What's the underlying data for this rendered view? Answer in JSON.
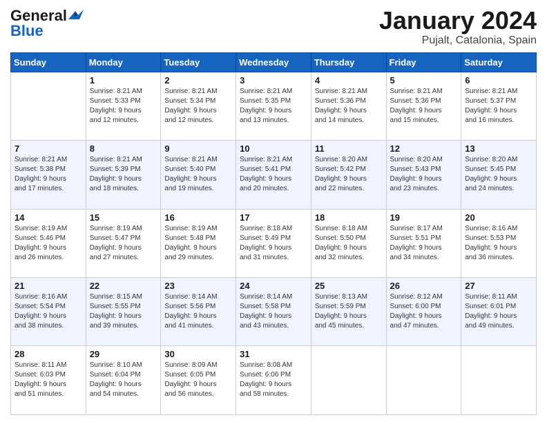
{
  "logo": {
    "line1": "General",
    "line2": "Blue"
  },
  "header": {
    "month": "January 2024",
    "location": "Pujalt, Catalonia, Spain"
  },
  "weekdays": [
    "Sunday",
    "Monday",
    "Tuesday",
    "Wednesday",
    "Thursday",
    "Friday",
    "Saturday"
  ],
  "weeks": [
    [
      {
        "day": "",
        "info": ""
      },
      {
        "day": "1",
        "info": "Sunrise: 8:21 AM\nSunset: 5:33 PM\nDaylight: 9 hours\nand 12 minutes."
      },
      {
        "day": "2",
        "info": "Sunrise: 8:21 AM\nSunset: 5:34 PM\nDaylight: 9 hours\nand 12 minutes."
      },
      {
        "day": "3",
        "info": "Sunrise: 8:21 AM\nSunset: 5:35 PM\nDaylight: 9 hours\nand 13 minutes."
      },
      {
        "day": "4",
        "info": "Sunrise: 8:21 AM\nSunset: 5:36 PM\nDaylight: 9 hours\nand 14 minutes."
      },
      {
        "day": "5",
        "info": "Sunrise: 8:21 AM\nSunset: 5:36 PM\nDaylight: 9 hours\nand 15 minutes."
      },
      {
        "day": "6",
        "info": "Sunrise: 8:21 AM\nSunset: 5:37 PM\nDaylight: 9 hours\nand 16 minutes."
      }
    ],
    [
      {
        "day": "7",
        "info": "Sunrise: 8:21 AM\nSunset: 5:38 PM\nDaylight: 9 hours\nand 17 minutes."
      },
      {
        "day": "8",
        "info": "Sunrise: 8:21 AM\nSunset: 5:39 PM\nDaylight: 9 hours\nand 18 minutes."
      },
      {
        "day": "9",
        "info": "Sunrise: 8:21 AM\nSunset: 5:40 PM\nDaylight: 9 hours\nand 19 minutes."
      },
      {
        "day": "10",
        "info": "Sunrise: 8:21 AM\nSunset: 5:41 PM\nDaylight: 9 hours\nand 20 minutes."
      },
      {
        "day": "11",
        "info": "Sunrise: 8:20 AM\nSunset: 5:42 PM\nDaylight: 9 hours\nand 22 minutes."
      },
      {
        "day": "12",
        "info": "Sunrise: 8:20 AM\nSunset: 5:43 PM\nDaylight: 9 hours\nand 23 minutes."
      },
      {
        "day": "13",
        "info": "Sunrise: 8:20 AM\nSunset: 5:45 PM\nDaylight: 9 hours\nand 24 minutes."
      }
    ],
    [
      {
        "day": "14",
        "info": "Sunrise: 8:19 AM\nSunset: 5:46 PM\nDaylight: 9 hours\nand 26 minutes."
      },
      {
        "day": "15",
        "info": "Sunrise: 8:19 AM\nSunset: 5:47 PM\nDaylight: 9 hours\nand 27 minutes."
      },
      {
        "day": "16",
        "info": "Sunrise: 8:19 AM\nSunset: 5:48 PM\nDaylight: 9 hours\nand 29 minutes."
      },
      {
        "day": "17",
        "info": "Sunrise: 8:18 AM\nSunset: 5:49 PM\nDaylight: 9 hours\nand 31 minutes."
      },
      {
        "day": "18",
        "info": "Sunrise: 8:18 AM\nSunset: 5:50 PM\nDaylight: 9 hours\nand 32 minutes."
      },
      {
        "day": "19",
        "info": "Sunrise: 8:17 AM\nSunset: 5:51 PM\nDaylight: 9 hours\nand 34 minutes."
      },
      {
        "day": "20",
        "info": "Sunrise: 8:16 AM\nSunset: 5:53 PM\nDaylight: 9 hours\nand 36 minutes."
      }
    ],
    [
      {
        "day": "21",
        "info": "Sunrise: 8:16 AM\nSunset: 5:54 PM\nDaylight: 9 hours\nand 38 minutes."
      },
      {
        "day": "22",
        "info": "Sunrise: 8:15 AM\nSunset: 5:55 PM\nDaylight: 9 hours\nand 39 minutes."
      },
      {
        "day": "23",
        "info": "Sunrise: 8:14 AM\nSunset: 5:56 PM\nDaylight: 9 hours\nand 41 minutes."
      },
      {
        "day": "24",
        "info": "Sunrise: 8:14 AM\nSunset: 5:58 PM\nDaylight: 9 hours\nand 43 minutes."
      },
      {
        "day": "25",
        "info": "Sunrise: 8:13 AM\nSunset: 5:59 PM\nDaylight: 9 hours\nand 45 minutes."
      },
      {
        "day": "26",
        "info": "Sunrise: 8:12 AM\nSunset: 6:00 PM\nDaylight: 9 hours\nand 47 minutes."
      },
      {
        "day": "27",
        "info": "Sunrise: 8:11 AM\nSunset: 6:01 PM\nDaylight: 9 hours\nand 49 minutes."
      }
    ],
    [
      {
        "day": "28",
        "info": "Sunrise: 8:11 AM\nSunset: 6:03 PM\nDaylight: 9 hours\nand 51 minutes."
      },
      {
        "day": "29",
        "info": "Sunrise: 8:10 AM\nSunset: 6:04 PM\nDaylight: 9 hours\nand 54 minutes."
      },
      {
        "day": "30",
        "info": "Sunrise: 8:09 AM\nSunset: 6:05 PM\nDaylight: 9 hours\nand 56 minutes."
      },
      {
        "day": "31",
        "info": "Sunrise: 8:08 AM\nSunset: 6:06 PM\nDaylight: 9 hours\nand 58 minutes."
      },
      {
        "day": "",
        "info": ""
      },
      {
        "day": "",
        "info": ""
      },
      {
        "day": "",
        "info": ""
      }
    ]
  ]
}
